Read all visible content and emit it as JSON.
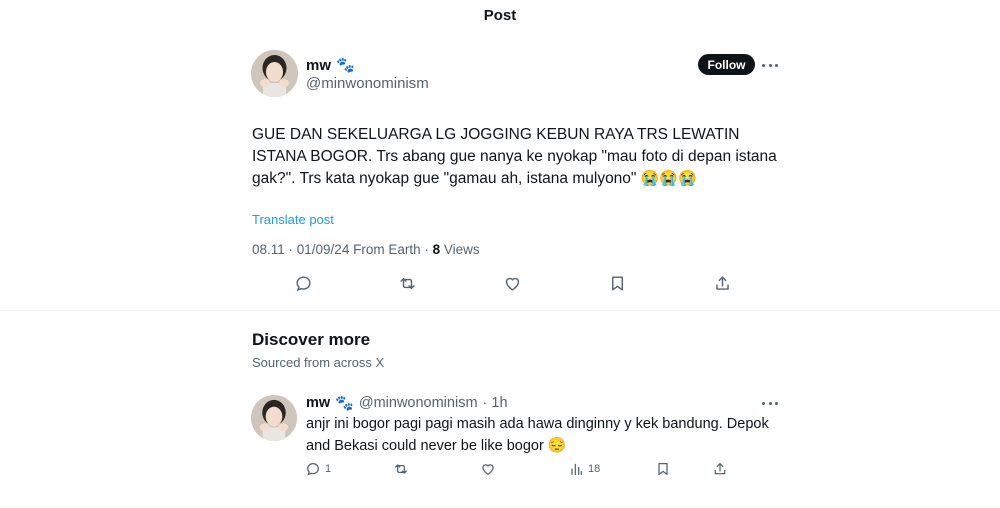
{
  "header": {
    "title": "Post"
  },
  "post": {
    "author_name": "mw",
    "author_badge": "🐾",
    "handle": "@minwonominism",
    "follow_label": "Follow",
    "text": "GUE DAN SEKELUARGA LG JOGGING KEBUN RAYA TRS LEWATIN ISTANA BOGOR. Trs abang gue nanya ke nyokap \"mau foto di depan istana gak?\". Trs kata nyokap gue \"gamau ah, istana mulyono\"",
    "text_emojis": "😭😭😭",
    "translate_label": "Translate post",
    "time": "08.11 · 01/09/24 From Earth · ",
    "views_count": "8",
    "views_label": " Views"
  },
  "discover": {
    "title": "Discover more",
    "subtitle": "Sourced from across X"
  },
  "related_post": {
    "author_name": "mw",
    "author_badge": "🐾",
    "handle": "@minwonominism",
    "time": "· 1h",
    "text": "anjr ini bogor pagi pagi masih ada hawa dinginny y kek bandung. Depok and Bekasi could never be like bogor",
    "text_emoji": "😔",
    "reply_count": "1",
    "views_count": "18"
  },
  "colors": {
    "text_primary": "#0f1419",
    "text_secondary": "#536471",
    "link": "#1d9bf0",
    "follow_bg": "#0f1419"
  }
}
